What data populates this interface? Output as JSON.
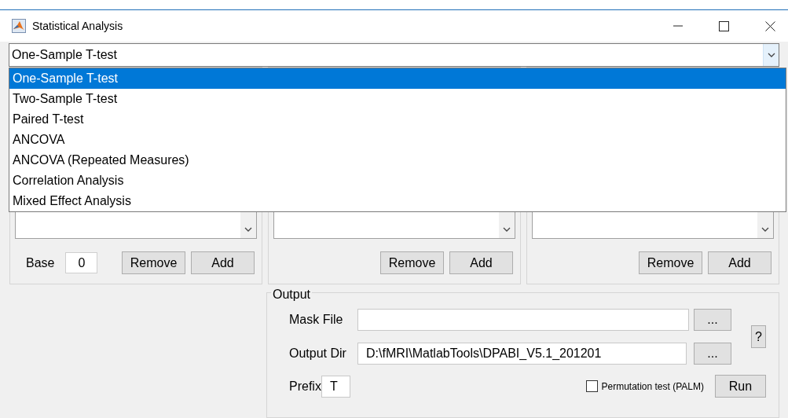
{
  "window": {
    "title": "Statistical Analysis"
  },
  "test_type": {
    "value": "One-Sample T-test",
    "expanded": true,
    "options": [
      {
        "label": "One-Sample T-test",
        "selected": true
      },
      {
        "label": "Two-Sample T-test",
        "selected": false
      },
      {
        "label": "Paired T-test",
        "selected": false
      },
      {
        "label": "ANCOVA",
        "selected": false
      },
      {
        "label": "ANCOVA (Repeated Measures)",
        "selected": false
      },
      {
        "label": "Correlation Analysis",
        "selected": false
      },
      {
        "label": "Mixed Effect Analysis",
        "selected": false
      }
    ]
  },
  "groups": [
    {
      "kind": "base",
      "base_label": "Base",
      "base_value": "0",
      "buttons": [
        "Remove",
        "Add"
      ]
    },
    {
      "kind": "plain",
      "buttons": [
        "Remove",
        "Add"
      ]
    },
    {
      "kind": "plain",
      "buttons": [
        "Remove",
        "Add"
      ]
    }
  ],
  "output": {
    "title": "Output",
    "mask_file": {
      "label": "Mask File",
      "button": "..."
    },
    "output_dir": {
      "label": "Output Dir",
      "value": "D:\\fMRI\\MatlabTools\\DPABI_V5.1_201201",
      "button": "..."
    },
    "help": "?",
    "prefix": {
      "label": "Prefix",
      "value": "T"
    },
    "permutation": {
      "label": "Permutation test (PALM)",
      "checked": false
    },
    "run": "Run"
  }
}
